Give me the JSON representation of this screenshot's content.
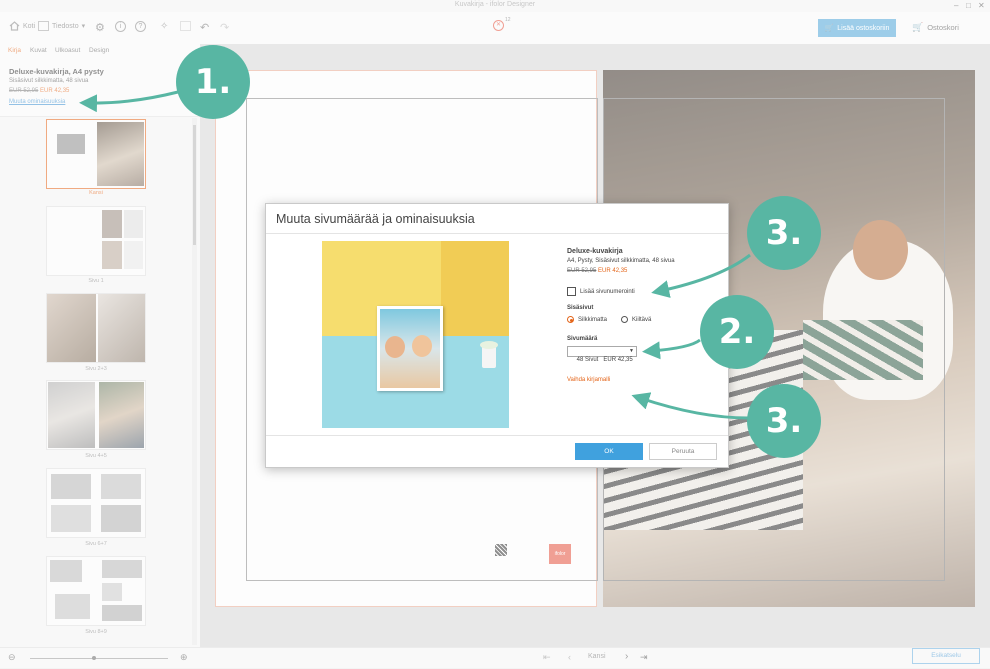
{
  "window": {
    "title": "Kuvakirja - ifolor Designer",
    "controls": [
      "–",
      "□",
      "✕"
    ]
  },
  "toolbar": {
    "home_label": "Koti",
    "file_label": "Tiedosto",
    "error_count": "12",
    "add_to_cart": "Lisää ostoskoriin",
    "basket": "Ostoskori"
  },
  "sidebar": {
    "tabs": [
      "Kirja",
      "Kuvat",
      "Ulkoasut",
      "Design"
    ],
    "active_tab": "Kirja",
    "product_title": "Deluxe-kuvakirja, A4 pysty",
    "product_sub": "Sisäsivut silkkimatta, 48 sivua",
    "price_old": "EUR 52,95",
    "price_new": "EUR 42,35",
    "change_link": "Muuta ominaisuuksia",
    "thumb_labels": [
      "Kansi",
      "Sivu 1",
      "Sivu 2+3",
      "Sivu 4+5",
      "Sivu 6+7",
      "Sivu 8+9"
    ]
  },
  "canvas": {
    "nav_label": "Kansi",
    "preview_button": "Esikatselu",
    "logo_text": "ifolor"
  },
  "dialog": {
    "title": "Muuta sivumäärää ja ominaisuuksia",
    "product_title": "Deluxe-kuvakirja",
    "product_sub": "A4, Pysty, Sisäsivut silkkimatta, 48 sivua",
    "price_old": "EUR 52,95",
    "price_new": "EUR 42,35",
    "page_numbering_label": "Lisää sivunumerointi",
    "page_numbering_checked": false,
    "inner_pages_heading": "Sisäsivut",
    "finish_options": [
      "Silkkimatta",
      "Kiiltävä"
    ],
    "finish_selected": "Silkkimatta",
    "page_count_heading": "Sivumäärä",
    "page_count_value": "48 Sivut   EUR 42,35",
    "change_model_link": "Vaihda kirjamalli",
    "ok_label": "OK",
    "cancel_label": "Peruuta"
  },
  "callouts": [
    "1.",
    "2.",
    "3.",
    "3."
  ],
  "colors": {
    "accent": "#e4651a",
    "primary_button": "#40a1de",
    "callout": "#58b6a3",
    "error": "#e4513c"
  }
}
